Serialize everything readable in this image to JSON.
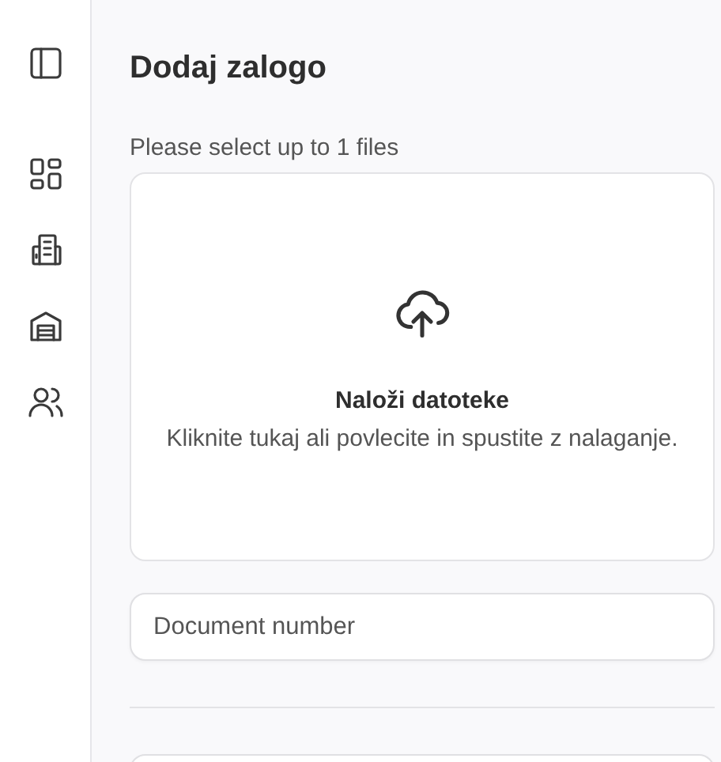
{
  "page_title": "Dodaj zalogo",
  "upload": {
    "hint": "Please select up to 1 files",
    "title": "Naloži datoteke",
    "description": "Kliknite tukaj ali povlecite in spustite z nalaganje."
  },
  "form": [
    {
      "kind": "input",
      "placeholder": "Document number"
    },
    {
      "kind": "divider"
    },
    {
      "kind": "input"
    }
  ]
}
